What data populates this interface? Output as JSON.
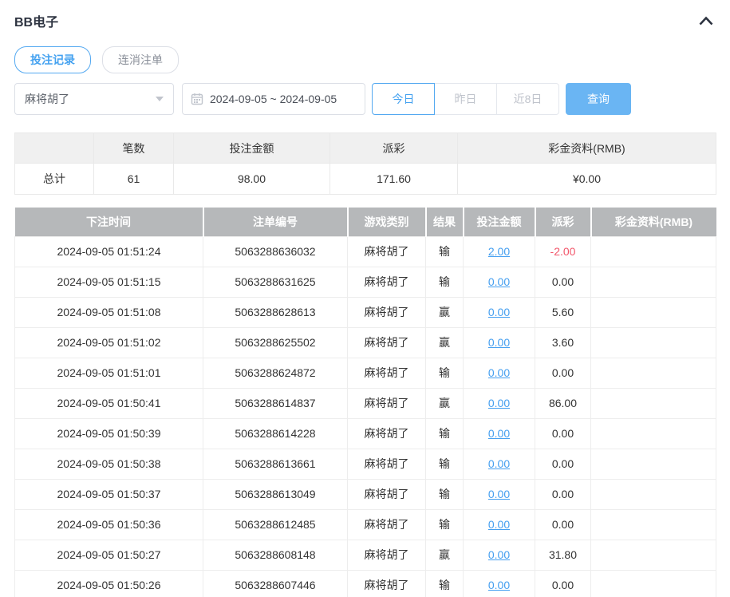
{
  "header": {
    "title": "BB电子"
  },
  "tabs": [
    {
      "label": "投注记录",
      "active": true
    },
    {
      "label": "连消注单",
      "active": false
    }
  ],
  "filters": {
    "game_select": {
      "value": "麻将胡了"
    },
    "date_range": {
      "value": "2024-09-05 ~ 2024-09-05"
    },
    "quick_buttons": [
      {
        "label": "今日",
        "active": true
      },
      {
        "label": "昨日",
        "active": false
      },
      {
        "label": "近8日",
        "active": false
      }
    ],
    "search_label": "查询"
  },
  "summary_table": {
    "headers": [
      "",
      "笔数",
      "投注金额",
      "派彩",
      "彩金资料(RMB)"
    ],
    "row": [
      "总计",
      "61",
      "98.00",
      "171.60",
      "¥0.00"
    ]
  },
  "detail_table": {
    "headers": [
      "下注时间",
      "注单编号",
      "游戏类别",
      "结果",
      "投注金额",
      "派彩",
      "彩金资料(RMB)"
    ],
    "rows": [
      {
        "time": "2024-09-05 01:51:24",
        "order_no": "5063288636032",
        "game": "麻将胡了",
        "result": "输",
        "bet": "2.00",
        "payout": "-2.00",
        "bonus": ""
      },
      {
        "time": "2024-09-05 01:51:15",
        "order_no": "5063288631625",
        "game": "麻将胡了",
        "result": "输",
        "bet": "0.00",
        "payout": "0.00",
        "bonus": ""
      },
      {
        "time": "2024-09-05 01:51:08",
        "order_no": "5063288628613",
        "game": "麻将胡了",
        "result": "赢",
        "bet": "0.00",
        "payout": "5.60",
        "bonus": ""
      },
      {
        "time": "2024-09-05 01:51:02",
        "order_no": "5063288625502",
        "game": "麻将胡了",
        "result": "赢",
        "bet": "0.00",
        "payout": "3.60",
        "bonus": ""
      },
      {
        "time": "2024-09-05 01:51:01",
        "order_no": "5063288624872",
        "game": "麻将胡了",
        "result": "输",
        "bet": "0.00",
        "payout": "0.00",
        "bonus": ""
      },
      {
        "time": "2024-09-05 01:50:41",
        "order_no": "5063288614837",
        "game": "麻将胡了",
        "result": "赢",
        "bet": "0.00",
        "payout": "86.00",
        "bonus": ""
      },
      {
        "time": "2024-09-05 01:50:39",
        "order_no": "5063288614228",
        "game": "麻将胡了",
        "result": "输",
        "bet": "0.00",
        "payout": "0.00",
        "bonus": ""
      },
      {
        "time": "2024-09-05 01:50:38",
        "order_no": "5063288613661",
        "game": "麻将胡了",
        "result": "输",
        "bet": "0.00",
        "payout": "0.00",
        "bonus": ""
      },
      {
        "time": "2024-09-05 01:50:37",
        "order_no": "5063288613049",
        "game": "麻将胡了",
        "result": "输",
        "bet": "0.00",
        "payout": "0.00",
        "bonus": ""
      },
      {
        "time": "2024-09-05 01:50:36",
        "order_no": "5063288612485",
        "game": "麻将胡了",
        "result": "输",
        "bet": "0.00",
        "payout": "0.00",
        "bonus": ""
      },
      {
        "time": "2024-09-05 01:50:27",
        "order_no": "5063288608148",
        "game": "麻将胡了",
        "result": "赢",
        "bet": "0.00",
        "payout": "31.80",
        "bonus": ""
      },
      {
        "time": "2024-09-05 01:50:26",
        "order_no": "5063288607446",
        "game": "麻将胡了",
        "result": "输",
        "bet": "0.00",
        "payout": "0.00",
        "bonus": ""
      }
    ]
  },
  "colors": {
    "accent": "#45a2f0",
    "search_button": "#6ab5f3",
    "negative": "#f2566a",
    "detail_header_bg": "#b6b8ba",
    "summary_header_bg": "#f0f0f0",
    "link": "#459ff0"
  }
}
